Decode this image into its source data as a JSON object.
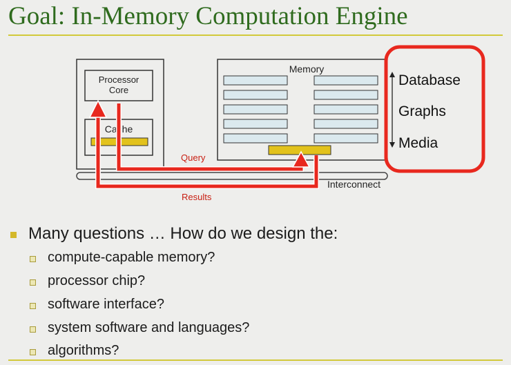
{
  "title": "Goal: In-Memory Computation Engine",
  "diagram": {
    "processor_core_label": "Processor\nCore",
    "cache_label": "Cache",
    "memory_label": "Memory",
    "query_label": "Query",
    "results_label": "Results",
    "interconnect_label": "Interconnect",
    "data_types": [
      "Database",
      "Graphs",
      "Media"
    ],
    "colors": {
      "arrow": "#e8281e",
      "highlight_box": "#e8281e",
      "compute_unit": "#e2c21c",
      "memory_rows": "#dbe9ee"
    }
  },
  "bullets": {
    "main": "Many questions … How do we design the:",
    "sub": [
      "compute-capable memory?",
      "processor chip?",
      "software interface?",
      "system software and languages?",
      "algorithms?"
    ]
  }
}
